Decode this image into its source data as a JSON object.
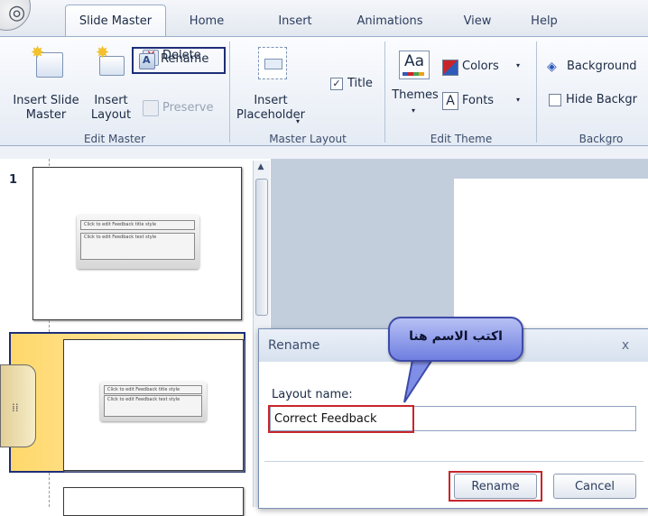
{
  "ribbon": {
    "tabs": [
      "Slide Master",
      "Home",
      "Insert",
      "Animations",
      "View",
      "Help"
    ],
    "active_tab": "Slide Master",
    "edit_master": {
      "insert_slide_master": [
        "Insert Slide",
        "Master"
      ],
      "insert_layout": [
        "Insert",
        "Layout"
      ],
      "delete": "Delete",
      "rename": "Rename",
      "preserve": "Preserve",
      "group_label": "Edit Master"
    },
    "master_layout": {
      "insert_placeholder": [
        "Insert",
        "Placeholder"
      ],
      "title_checkbox": "Title",
      "group_label": "Master Layout"
    },
    "edit_theme": {
      "themes": "Themes",
      "themes_glyph": "Aa",
      "colors": "Colors",
      "fonts": "Fonts",
      "fonts_glyph": "A",
      "group_label": "Edit Theme"
    },
    "background": {
      "background_styles": "Background",
      "hide_background": "Hide Backgr",
      "group_label": "Backgro"
    }
  },
  "thumbnails": [
    {
      "number": "1",
      "title_text": "Click to edit Feedback title style",
      "body_text": "Click to edit Feedback text style"
    },
    {
      "number": "",
      "title_text": "Click to edit Feedback title style",
      "body_text": "Click to edit Feedback text style"
    }
  ],
  "dialog": {
    "title": "Rename",
    "close_glyph": "x",
    "field_label": "Layout name:",
    "field_value": "Correct Feedback",
    "ok_label": "Rename",
    "cancel_label": "Cancel"
  },
  "callout": {
    "text": "اكتب الاسم هنا"
  },
  "colors": {
    "highlight_red": "#c8252b",
    "highlight_navy": "#1d2e78",
    "callout_blue": "#7f8ee6"
  }
}
